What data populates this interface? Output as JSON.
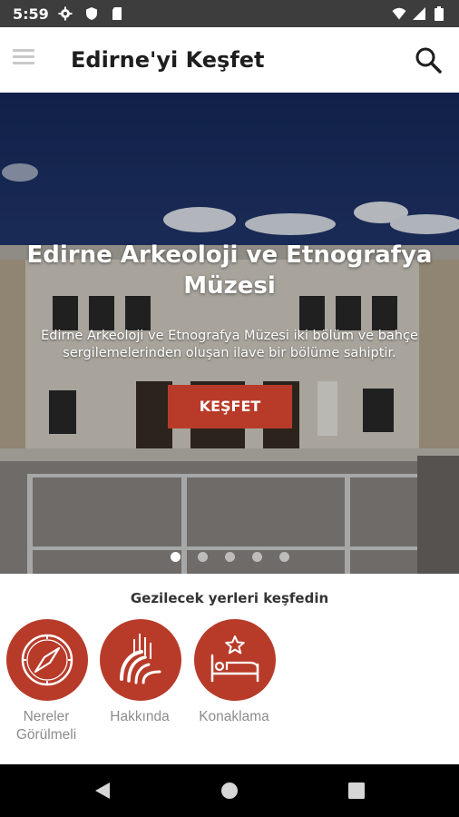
{
  "status_bar": {
    "time": "5:59",
    "left_icons": [
      "settings-icon",
      "shield-icon",
      "sd-card-icon"
    ],
    "right_icons": [
      "wifi-icon",
      "signal-icon",
      "battery-icon"
    ]
  },
  "app_bar": {
    "title": "Edirne'yi Keşfet",
    "menu_icon": "hamburger-menu-icon",
    "search_icon": "search-icon"
  },
  "hero": {
    "title": "Edirne Arkeoloji ve Etnografya Müzesi",
    "description": "Edirne Arkeoloji ve Etnografya Müzesi iki bölüm ve bahçe sergilemelerinden oluşan ilave bir bölüme sahiptir.",
    "button_label": "KEŞFET",
    "slide_count": 5,
    "active_slide": 1
  },
  "categories": {
    "title": "Gezilecek yerleri keşfedin",
    "items": [
      {
        "label": "Nereler Görülmeli",
        "icon": "compass-icon"
      },
      {
        "label": "Hakkında",
        "icon": "edirne-logo-icon"
      },
      {
        "label": "Konaklama",
        "icon": "bed-star-icon"
      }
    ]
  },
  "colors": {
    "accent": "#b83b2a",
    "status_bar": "#3d3d3d",
    "nav_bar": "#000000",
    "label_grey": "#8c8c8c"
  },
  "nav_bar": {
    "buttons": [
      "back-icon",
      "home-icon",
      "recents-icon"
    ]
  }
}
